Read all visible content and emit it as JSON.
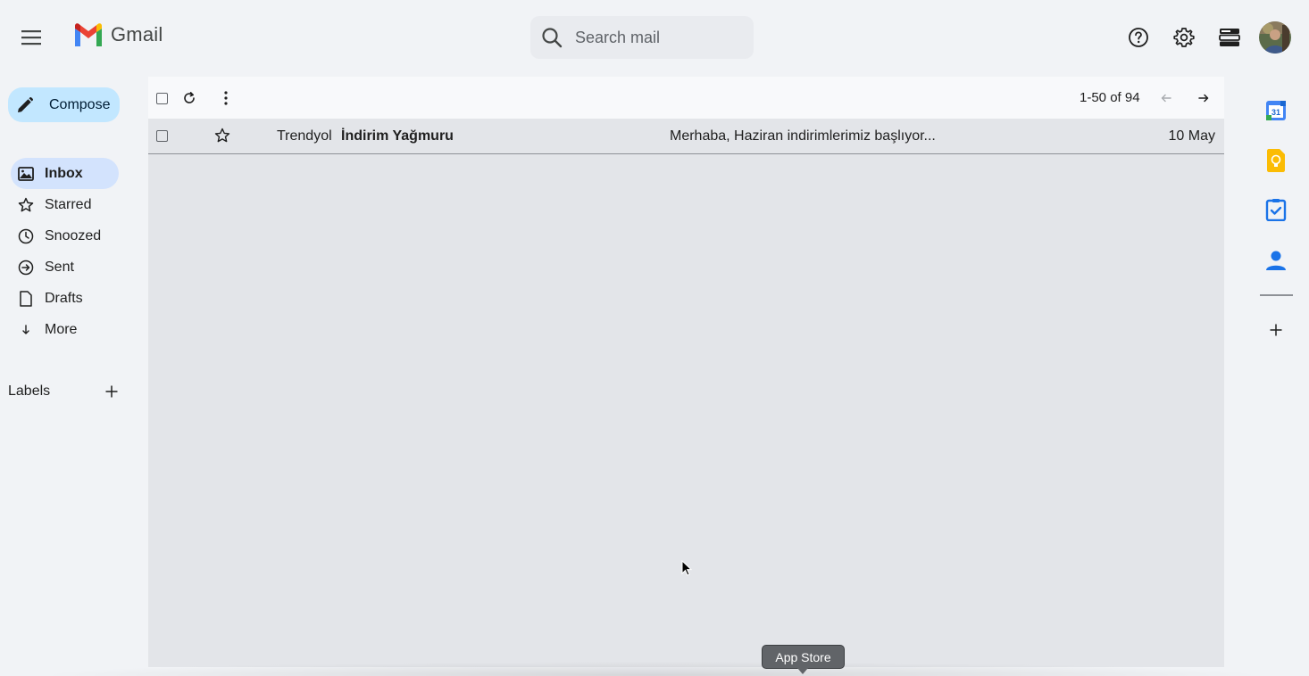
{
  "header": {
    "app_name": "Gmail",
    "search_placeholder": "Search mail"
  },
  "compose": {
    "label": "Compose"
  },
  "nav": {
    "items": [
      {
        "label": "Inbox",
        "icon": "inbox-icon",
        "active": true
      },
      {
        "label": "Starred",
        "icon": "star-icon"
      },
      {
        "label": "Snoozed",
        "icon": "clock-icon"
      },
      {
        "label": "Sent",
        "icon": "send-icon"
      },
      {
        "label": "Drafts",
        "icon": "draft-icon"
      },
      {
        "label": "More",
        "icon": "arrow-down-icon"
      }
    ]
  },
  "labels": {
    "title": "Labels"
  },
  "toolbar": {
    "pagination": "1-50 of 94"
  },
  "emails": [
    {
      "sender": "Trendyol",
      "subject": "İndirim Yağmuru",
      "snippet": "Merhaba, Haziran indirimlerimiz başlıyor...",
      "date": "10 May"
    }
  ],
  "side_panel": {
    "calendar_day": "31"
  },
  "dock": {
    "tooltip": "App Store"
  },
  "colors": {
    "background": "#f1f3f6",
    "compose": "#c2e7ff",
    "active_nav": "#d3e3fd",
    "gmail_red": "#ea4335",
    "gmail_blue": "#4285f4",
    "gmail_green": "#34a853",
    "gmail_yellow": "#fbbc04"
  }
}
